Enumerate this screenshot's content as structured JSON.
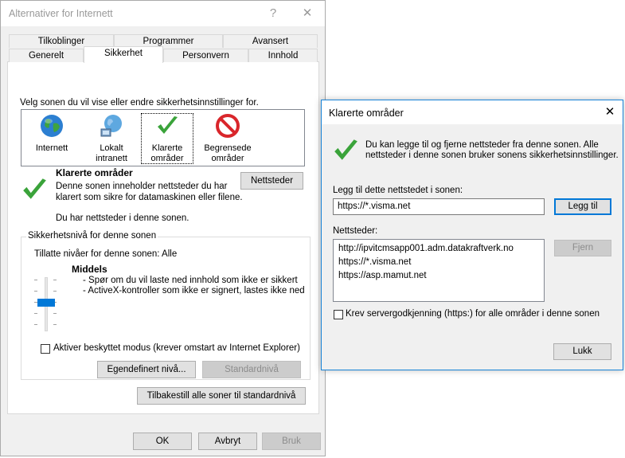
{
  "main_window": {
    "title": "Alternativer for Internett",
    "help_glyph": "?",
    "close_glyph": "✕",
    "tabs_row1": [
      "Tilkoblinger",
      "Programmer",
      "Avansert"
    ],
    "tabs_row2": [
      "Generelt",
      "Sikkerhet",
      "Personvern",
      "Innhold"
    ],
    "active_tab": "Sikkerhet",
    "zone_prompt": "Velg sonen du vil vise eller endre sikkerhetsinnstillinger for.",
    "zones": [
      {
        "line1": "Internett",
        "line2": "",
        "icon": "globe-icon"
      },
      {
        "line1": "Lokalt",
        "line2": "intranett",
        "icon": "intranet-globe-icon"
      },
      {
        "line1": "Klarerte",
        "line2": "områder",
        "icon": "checkmark-icon"
      },
      {
        "line1": "Begrensede",
        "line2": "områder",
        "icon": "restricted-icon"
      }
    ],
    "zone_heading": "Klarerte områder",
    "zone_desc_line1": "Denne sonen inneholder nettsteder du har",
    "zone_desc_line2": "klarert som sikre for datamaskinen eller filene.",
    "zone_has_sites": "Du har nettsteder i denne sonen.",
    "sites_button": "Nettsteder",
    "security_group_label": "Sikkerhetsnivå for denne sonen",
    "allowed_levels": "Tillatte nivåer for denne sonen: Alle",
    "level_name": "Middels",
    "level_bullet1": "- Spør om du vil laste ned innhold som ikke er sikkert",
    "level_bullet2": "- ActiveX-kontroller som ikke er signert, lastes ikke ned",
    "protected_mode": "Aktiver beskyttet modus (krever omstart av Internet Explorer)",
    "protected_mode_checked": false,
    "custom_level_button": "Egendefinert nivå...",
    "default_level_button": "Standardnivå",
    "reset_all_button": "Tilbakestill alle soner til standardnivå",
    "ok_button": "OK",
    "cancel_button": "Avbryt",
    "apply_button": "Bruk"
  },
  "trusted_dialog": {
    "title": "Klarerte områder",
    "close_glyph": "✕",
    "info_line1": "Du kan legge til og fjerne nettsteder fra denne sonen. Alle",
    "info_line2": "nettsteder i denne sonen bruker sonens sikkerhetsinnstillinger.",
    "add_label": "Legg til dette nettstedet i sonen:",
    "add_value": "https://*.visma.net",
    "add_button": "Legg til",
    "sites_label": "Nettsteder:",
    "sites": [
      "http://ipvitcmsapp001.adm.datakraftverk.no",
      "https://*.visma.net",
      "https://asp.mamut.net"
    ],
    "remove_button": "Fjern",
    "require_https_label": "Krev servergodkjenning (https:) for alle områder i denne sonen",
    "require_https_checked": false,
    "close_button": "Lukk"
  },
  "colors": {
    "accent": "#0078d7",
    "check_green": "#3aa33a",
    "restricted_red": "#d9262b"
  }
}
